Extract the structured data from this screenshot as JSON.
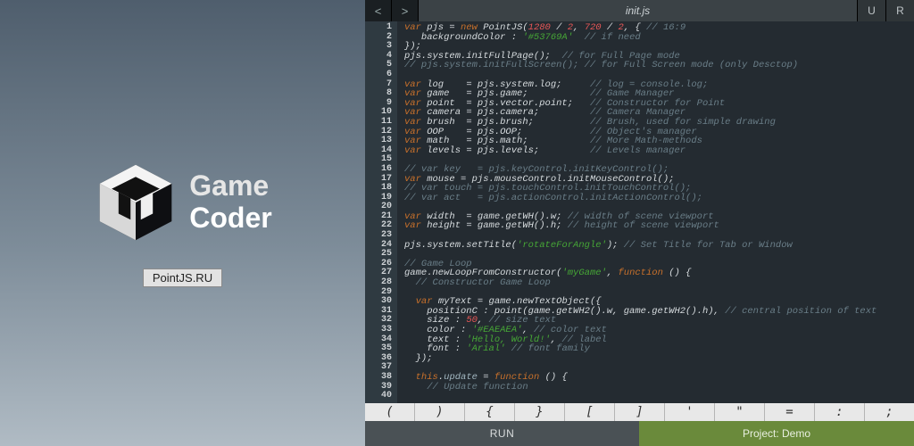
{
  "left_panel": {
    "logo_line1": "Game",
    "logo_line2": "Coder",
    "site_badge": "PointJS.RU"
  },
  "tabbar": {
    "prev": "<",
    "next": ">",
    "active_tab": "init.js",
    "btn_u": "U",
    "btn_r": "R"
  },
  "editor": {
    "lines": [
      [
        [
          "kw",
          "var"
        ],
        [
          "id",
          " pjs "
        ],
        [
          "id",
          "= "
        ],
        [
          "new",
          "new"
        ],
        [
          "id",
          " PointJS("
        ],
        [
          "num",
          "1280"
        ],
        [
          "id",
          " / "
        ],
        [
          "num",
          "2"
        ],
        [
          "id",
          ", "
        ],
        [
          "num",
          "720"
        ],
        [
          "id",
          " / "
        ],
        [
          "num",
          "2"
        ],
        [
          "id",
          ", { "
        ],
        [
          "cm",
          "// 16:9"
        ]
      ],
      [
        [
          "id",
          "   backgroundColor : "
        ],
        [
          "str",
          "'#53769A'"
        ],
        [
          "id",
          "  "
        ],
        [
          "cm",
          "// if need"
        ]
      ],
      [
        [
          "id",
          "});"
        ]
      ],
      [
        [
          "id",
          "pjs.system.initFullPage();  "
        ],
        [
          "cm",
          "// for Full Page mode"
        ]
      ],
      [
        [
          "cm",
          "// pjs.system.initFullScreen(); // for Full Screen mode (only Desctop)"
        ]
      ],
      [],
      [
        [
          "kw",
          "var"
        ],
        [
          "id",
          " log    = pjs.system.log;     "
        ],
        [
          "cm",
          "// log = console.log;"
        ]
      ],
      [
        [
          "kw",
          "var"
        ],
        [
          "id",
          " game   = pjs.game;           "
        ],
        [
          "cm",
          "// Game Manager"
        ]
      ],
      [
        [
          "kw",
          "var"
        ],
        [
          "id",
          " point  = pjs.vector.point;   "
        ],
        [
          "cm",
          "// Constructor for Point"
        ]
      ],
      [
        [
          "kw",
          "var"
        ],
        [
          "id",
          " camera = pjs.camera;         "
        ],
        [
          "cm",
          "// Camera Manager"
        ]
      ],
      [
        [
          "kw",
          "var"
        ],
        [
          "id",
          " brush  = pjs.brush;          "
        ],
        [
          "cm",
          "// Brush, used for simple drawing"
        ]
      ],
      [
        [
          "kw",
          "var"
        ],
        [
          "id",
          " OOP    = pjs.OOP;            "
        ],
        [
          "cm",
          "// Object's manager"
        ]
      ],
      [
        [
          "kw",
          "var"
        ],
        [
          "id",
          " math   = pjs.math;           "
        ],
        [
          "cm",
          "// More Math-methods"
        ]
      ],
      [
        [
          "kw",
          "var"
        ],
        [
          "id",
          " levels = pjs.levels;         "
        ],
        [
          "cm",
          "// Levels manager"
        ]
      ],
      [],
      [
        [
          "cm",
          "// var key   = pjs.keyControl.initKeyControl();"
        ]
      ],
      [
        [
          "kw",
          "var"
        ],
        [
          "id",
          " mouse = pjs.mouseControl.initMouseControl();"
        ]
      ],
      [
        [
          "cm",
          "// var touch = pjs.touchControl.initTouchControl();"
        ]
      ],
      [
        [
          "cm",
          "// var act   = pjs.actionControl.initActionControl();"
        ]
      ],
      [],
      [
        [
          "kw",
          "var"
        ],
        [
          "id",
          " width  = game.getWH().w; "
        ],
        [
          "cm",
          "// width of scene viewport"
        ]
      ],
      [
        [
          "kw",
          "var"
        ],
        [
          "id",
          " height = game.getWH().h; "
        ],
        [
          "cm",
          "// height of scene viewport"
        ]
      ],
      [],
      [
        [
          "id",
          "pjs.system.setTitle("
        ],
        [
          "str",
          "'rotateForAngle'"
        ],
        [
          "id",
          "); "
        ],
        [
          "cm",
          "// Set Title for Tab or Window"
        ]
      ],
      [],
      [
        [
          "cm",
          "// Game Loop"
        ]
      ],
      [
        [
          "id",
          "game.newLoopFromConstructor("
        ],
        [
          "str",
          "'myGame'"
        ],
        [
          "id",
          ", "
        ],
        [
          "fn",
          "function"
        ],
        [
          "id",
          " () {"
        ]
      ],
      [
        [
          "id",
          "  "
        ],
        [
          "cm",
          "// Constructor Game Loop"
        ]
      ],
      [],
      [
        [
          "id",
          "  "
        ],
        [
          "kw",
          "var"
        ],
        [
          "id",
          " myText = game.newTextObject({"
        ]
      ],
      [
        [
          "id",
          "    positionC : point(game.getWH2().w, game.getWH2().h), "
        ],
        [
          "cm",
          "// central position of text"
        ]
      ],
      [
        [
          "id",
          "    size : "
        ],
        [
          "num",
          "50"
        ],
        [
          "id",
          ", "
        ],
        [
          "cm",
          "// size text"
        ]
      ],
      [
        [
          "id",
          "    color : "
        ],
        [
          "str",
          "'#EAEAEA'"
        ],
        [
          "id",
          ", "
        ],
        [
          "cm",
          "// color text"
        ]
      ],
      [
        [
          "id",
          "    text : "
        ],
        [
          "str",
          "'Hello, World!'"
        ],
        [
          "id",
          ", "
        ],
        [
          "cm",
          "// label"
        ]
      ],
      [
        [
          "id",
          "    font : "
        ],
        [
          "str",
          "'Arial'"
        ],
        [
          "id",
          " "
        ],
        [
          "cm",
          "// font family"
        ]
      ],
      [
        [
          "id",
          "  });"
        ]
      ],
      [],
      [
        [
          "id",
          "  "
        ],
        [
          "kw",
          "this"
        ],
        [
          "id",
          "."
        ],
        [
          "prop",
          "update"
        ],
        [
          "id",
          " = "
        ],
        [
          "fn",
          "function"
        ],
        [
          "id",
          " () {"
        ]
      ],
      [
        [
          "id",
          "    "
        ],
        [
          "cm",
          "// Update function"
        ]
      ],
      []
    ]
  },
  "symbol_bar": [
    "(",
    ")",
    "{",
    "}",
    "[",
    "]",
    "'",
    "\"",
    "=",
    ":",
    ";"
  ],
  "bottom": {
    "run": "RUN",
    "project": "Project: Demo"
  }
}
